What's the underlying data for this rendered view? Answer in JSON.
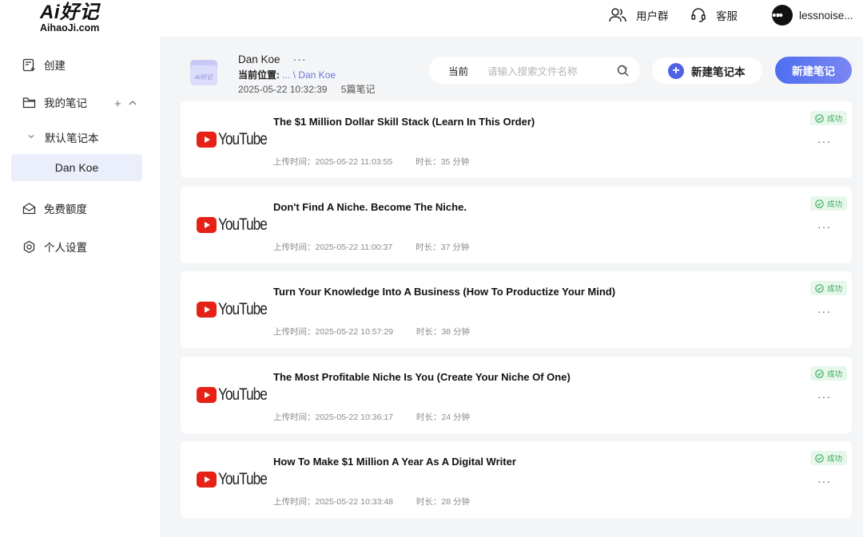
{
  "brand": {
    "line1": "Ai好记",
    "line2": "AihaoJi.com"
  },
  "topbar": {
    "community_label": "用户群",
    "service_label": "客服",
    "user_name": "lessnoise..."
  },
  "sidebar": {
    "create_label": "创建",
    "my_notes_label": "我的笔记",
    "add_symbol": "+",
    "collapse_symbol": "^",
    "default_notebook_label": "默认笔记本",
    "active_notebook": "Dan Koe",
    "free_quota_label": "免费额度",
    "settings_label": "个人设置"
  },
  "header": {
    "notebook_title": "Dan Koe",
    "more_symbol": "···",
    "location_label": "当前位置:",
    "location_path": " ... \\ Dan Koe",
    "timestamp": "2025-05-22 10:32:39",
    "note_count": "5篇笔记",
    "folder_tag": "Ai好记"
  },
  "search": {
    "scope": "当前",
    "placeholder": "请输入搜索文件名称"
  },
  "actions": {
    "new_notebook_label": "新建笔记本",
    "new_note_label": "新建笔记"
  },
  "source_brand": "YouTube",
  "status_success": "成功",
  "notes": [
    {
      "title": "The $1 Million Dollar Skill Stack (Learn In This Order)",
      "upload": "上传时间：2025-05-22 11:03:55",
      "duration": "时长：35 分钟"
    },
    {
      "title": "Don't Find A Niche. Become The Niche.",
      "upload": "上传时间：2025-05-22 11:00:37",
      "duration": "时长：37 分钟"
    },
    {
      "title": "Turn Your Knowledge Into A Business (How To Productize Your Mind)",
      "upload": "上传时间：2025-05-22 10:57:29",
      "duration": "时长：38 分钟"
    },
    {
      "title": "The Most Profitable Niche Is You (Create Your Niche Of One)",
      "upload": "上传时间：2025-05-22 10:36:17",
      "duration": "时长：24 分钟"
    },
    {
      "title": "How To Make $1 Million A Year As A Digital Writer",
      "upload": "上传时间：2025-05-22 10:33:48",
      "duration": "时长：28 分钟"
    }
  ]
}
